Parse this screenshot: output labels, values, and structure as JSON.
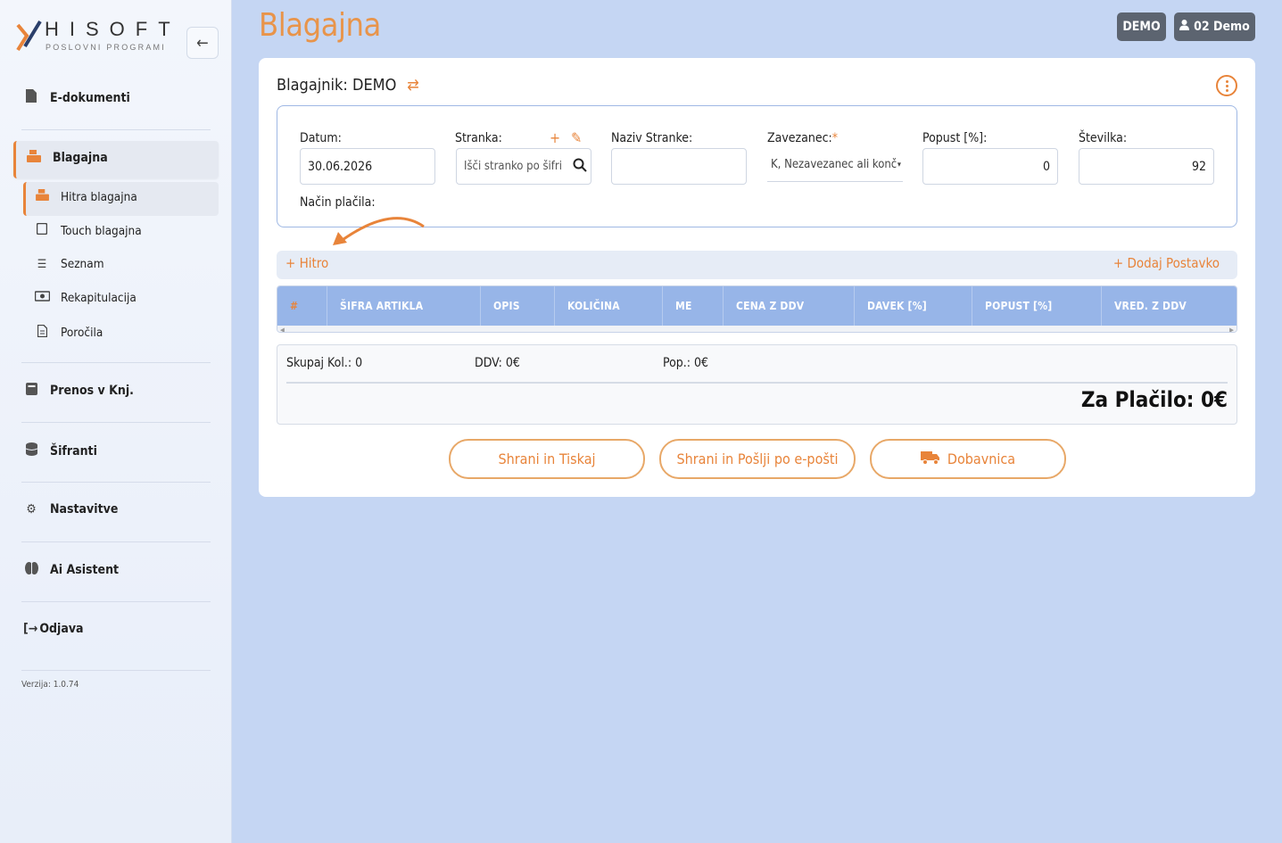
{
  "logo": {
    "name": "HISOFT",
    "tagline": "POSLOVNI PROGRAMI"
  },
  "sidebar": {
    "collapse_icon": "arrow-left-icon",
    "items": [
      {
        "label": "E-dokumenti",
        "icon": "file-icon"
      },
      {
        "label": "Blagajna",
        "icon": "cash-register-icon"
      },
      {
        "label": "Prenos v Knj.",
        "icon": "book-icon"
      },
      {
        "label": "Šifranti",
        "icon": "database-icon"
      },
      {
        "label": "Nastavitve",
        "icon": "gear-icon"
      },
      {
        "label": "Ai Asistent",
        "icon": "brain-icon"
      },
      {
        "label": "Odjava",
        "icon": "logout-icon"
      }
    ],
    "subitems": [
      {
        "label": "Hitra blagajna",
        "icon": "cash-register-icon"
      },
      {
        "label": "Touch blagajna",
        "icon": "tablet-icon"
      },
      {
        "label": "Seznam",
        "icon": "list-icon"
      },
      {
        "label": "Rekapitulacija",
        "icon": "money-icon"
      },
      {
        "label": "Poročila",
        "icon": "report-icon"
      }
    ],
    "version": "Verzija: 1.0.74"
  },
  "header": {
    "title": "Blagajna",
    "company_label": "DEMO",
    "user_label": "02 Demo"
  },
  "card": {
    "cashier": "Blagajnik: DEMO",
    "fields": {
      "datum_label": "Datum:",
      "datum_value": "30.06.2026",
      "stranka_label": "Stranka:",
      "stranka_placeholder": "Išči stranko po šifri",
      "naziv_label": "Naziv Stranke:",
      "naziv_value": "",
      "zavezanec_label": "Zavezanec:",
      "zavezanec_required": "*",
      "zavezanec_value": "K, Nezavezanec ali konč",
      "popust_label": "Popust [%]:",
      "popust_value": "0",
      "stevilka_label": "Številka:",
      "stevilka_value": "92",
      "nacin_label": "Način plačila:"
    },
    "toolbar": {
      "hitro": "+ Hitro",
      "dodaj": "+ Dodaj Postavko"
    },
    "table": {
      "columns": [
        "#",
        "ŠIFRA ARTIKLA",
        "OPIS",
        "KOLIČINA",
        "ME",
        "CENA Z DDV",
        "DAVEK [%]",
        "POPUST [%]",
        "VRED. Z DDV"
      ],
      "rows": []
    },
    "summary": {
      "skupaj": "Skupaj Kol.: 0",
      "ddv": "DDV: 0€",
      "pop": "Pop.: 0€",
      "za_placilo": "Za Plačilo: 0€"
    },
    "buttons": {
      "print": "Shrani in Tiskaj",
      "email": "Shrani in Pošlji po e-pošti",
      "delivery": "Dobavnica"
    }
  },
  "colors": {
    "accent": "#e8843a",
    "header_bg": "#97b5e8",
    "page_bg": "#c5d6f3"
  }
}
